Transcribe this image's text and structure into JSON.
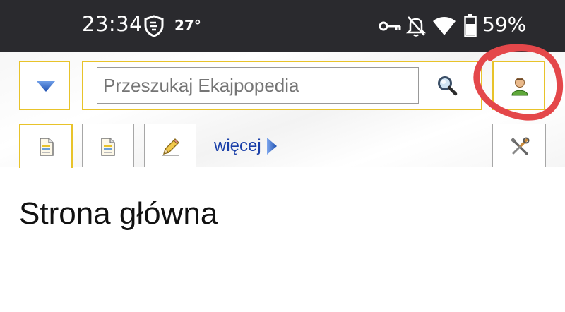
{
  "status_bar": {
    "time": "23:34",
    "temperature": "27°",
    "battery_percent": "59%",
    "icons": [
      "shield-icon",
      "vpn-key-icon",
      "bell-off-icon",
      "wifi-icon",
      "battery-icon"
    ]
  },
  "header": {
    "search_placeholder": "Przeszukaj Ekajpopedia",
    "icons": [
      "dropdown-arrow-icon",
      "search-icon",
      "user-icon"
    ],
    "accent_color": "#e8c32a",
    "annotation_color": "#e4474a"
  },
  "tabs": {
    "items": [
      {
        "icon": "page-icon",
        "active": true
      },
      {
        "icon": "discussion-page-icon",
        "active": false
      },
      {
        "icon": "pencil-icon",
        "active": false
      },
      {
        "icon": "tools-icon",
        "active": false
      }
    ],
    "more_label": "więcej"
  },
  "content": {
    "title": "Strona główna"
  }
}
